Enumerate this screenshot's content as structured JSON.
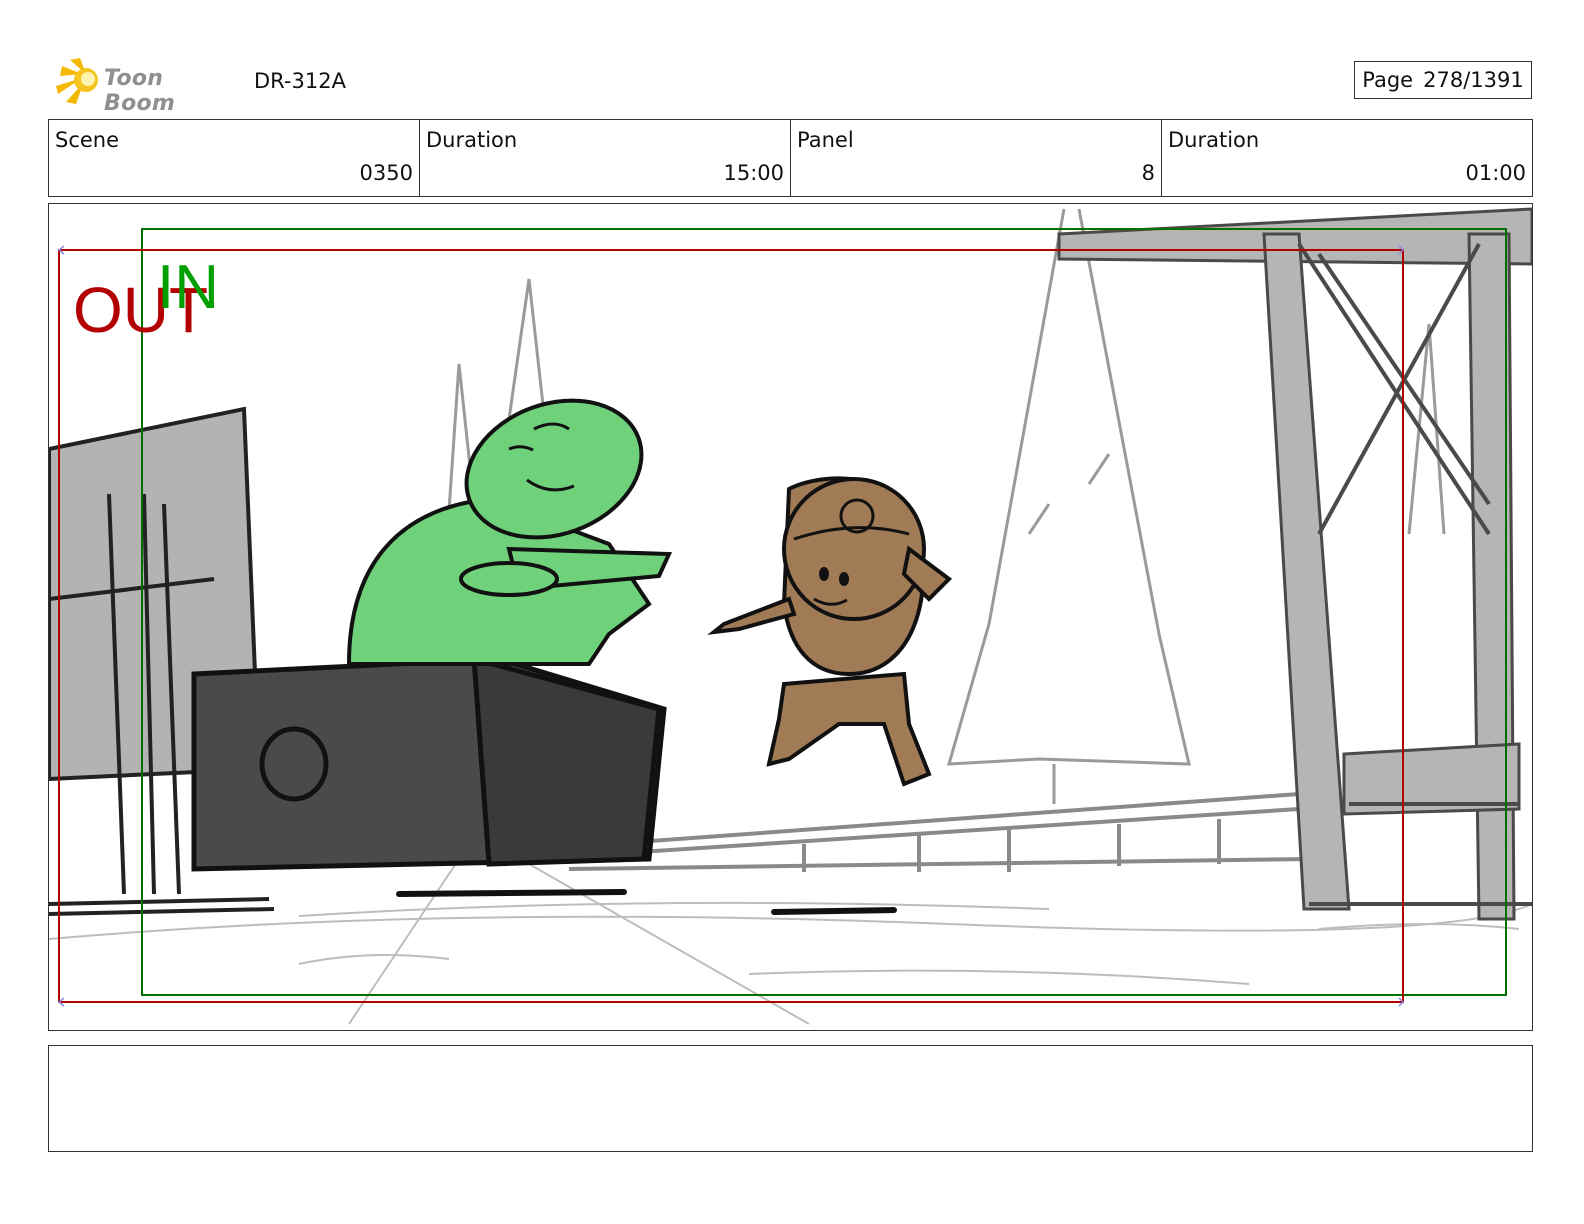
{
  "header": {
    "brand": "Toon Boom",
    "doc_id": "DR-312A",
    "page_label": "Page",
    "page_value": "278/1391"
  },
  "info": {
    "scene_label": "Scene",
    "scene_value": "0350",
    "scene_duration_label": "Duration",
    "scene_duration_value": "15:00",
    "panel_label": "Panel",
    "panel_value": "8",
    "panel_duration_label": "Duration",
    "panel_duration_value": "01:00"
  },
  "frame": {
    "out_label": "OUT",
    "in_label": "IN",
    "out_color": "#b30000",
    "in_color": "#00a000"
  },
  "notes": {
    "text": ""
  }
}
